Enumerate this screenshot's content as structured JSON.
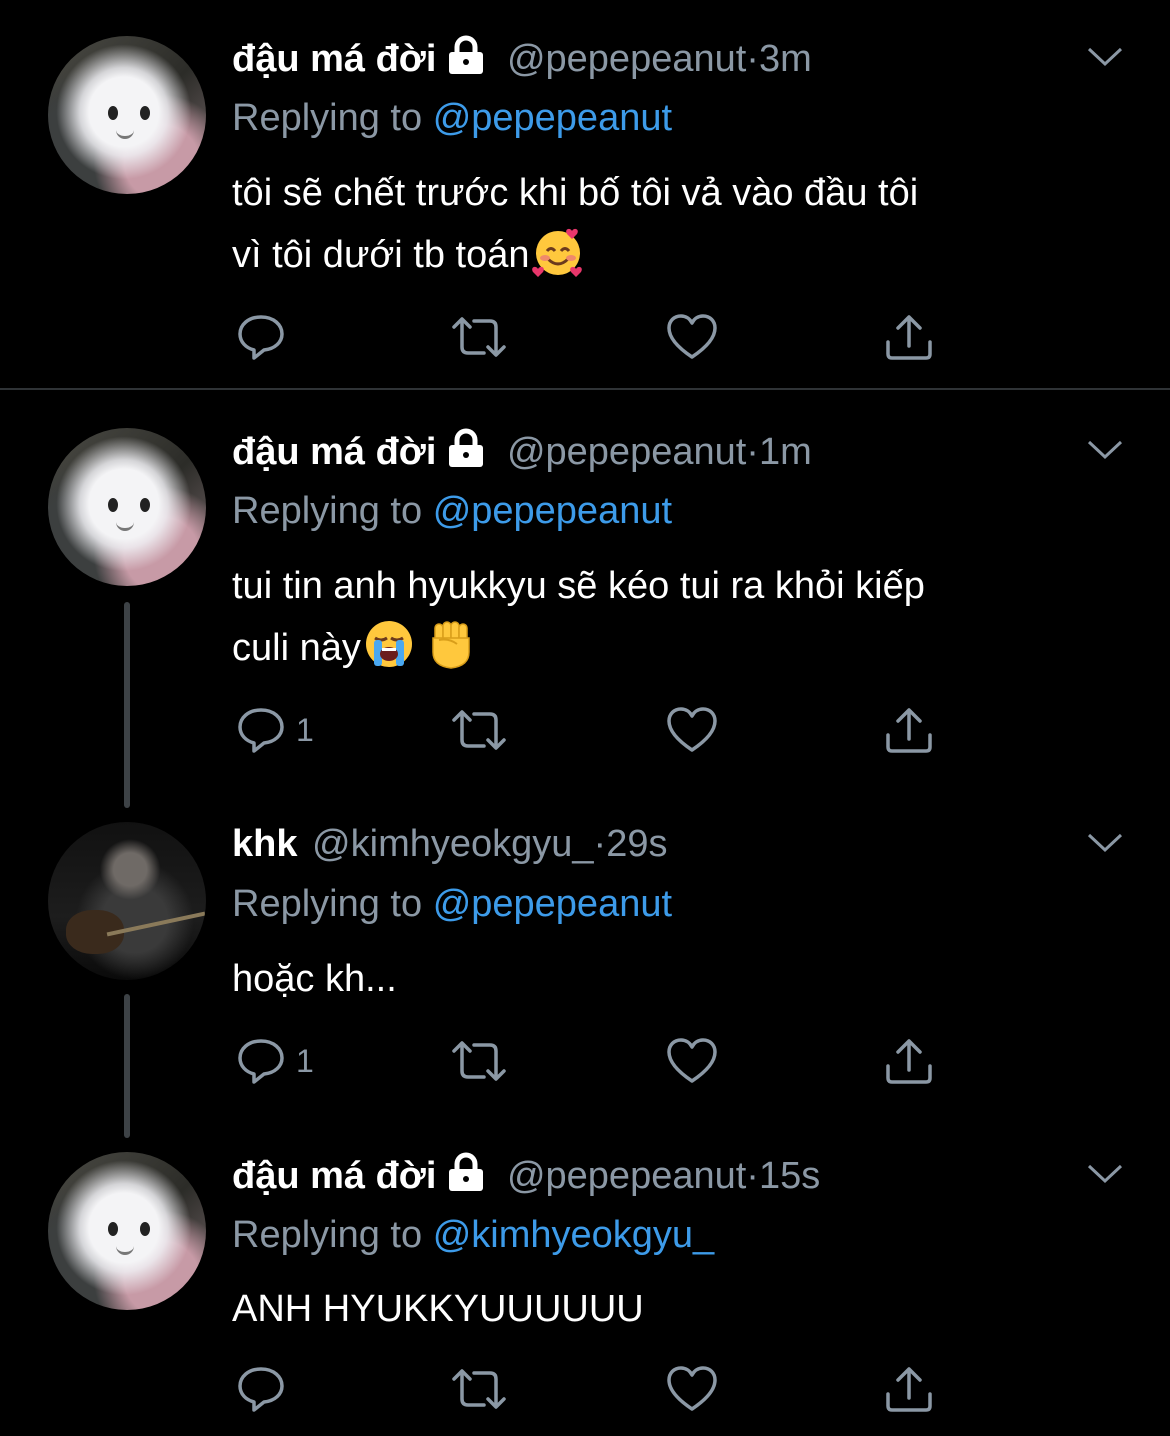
{
  "tweets": [
    {
      "name": "đậu má đời",
      "handle": "@pepepeanut",
      "time": "3m",
      "replying_prefix": "Replying to",
      "replying_to": "@pepepeanut",
      "text_lines": [
        "tôi sẽ chết trước khi bố tôi vả vào đầu tôi",
        "vì tôi dưới tb toán"
      ],
      "emojis": [
        "smiling-face-with-hearts"
      ],
      "reply_count": "",
      "locked": true
    },
    {
      "name": "đậu má đời",
      "handle": "@pepepeanut",
      "time": "1m",
      "replying_prefix": "Replying to",
      "replying_to": "@pepepeanut",
      "text_lines": [
        "tui tin anh hyukkyu sẽ kéo tui ra khỏi kiếp",
        "culi này"
      ],
      "emojis": [
        "loudly-crying-face",
        "raised-fist"
      ],
      "reply_count": "1",
      "locked": true
    },
    {
      "name": "khk",
      "handle": "@kimhyeokgyu_",
      "time": "29s",
      "replying_prefix": "Replying to",
      "replying_to": "@pepepeanut",
      "text_lines": [
        "hoặc kh..."
      ],
      "emojis": [],
      "reply_count": "1",
      "locked": false
    },
    {
      "name": "đậu má đời",
      "handle": "@pepepeanut",
      "time": "15s",
      "replying_prefix": "Replying to",
      "replying_to": "@kimhyeokgyu_",
      "text_lines": [
        "ANH HYUKKYUUUUUU"
      ],
      "emojis": [],
      "reply_count": "",
      "locked": true
    }
  ],
  "separator": "·",
  "icons": {
    "reply": "reply-icon",
    "retweet": "retweet-icon",
    "like": "heart-icon",
    "share": "share-icon",
    "more": "chevron-down-icon",
    "lock": "lock-icon"
  },
  "colors": {
    "background": "#000000",
    "secondary_text": "#8b98a5",
    "mention": "#3d9be9",
    "icon": "#8b98a5",
    "thread_line": "#3d4246"
  }
}
